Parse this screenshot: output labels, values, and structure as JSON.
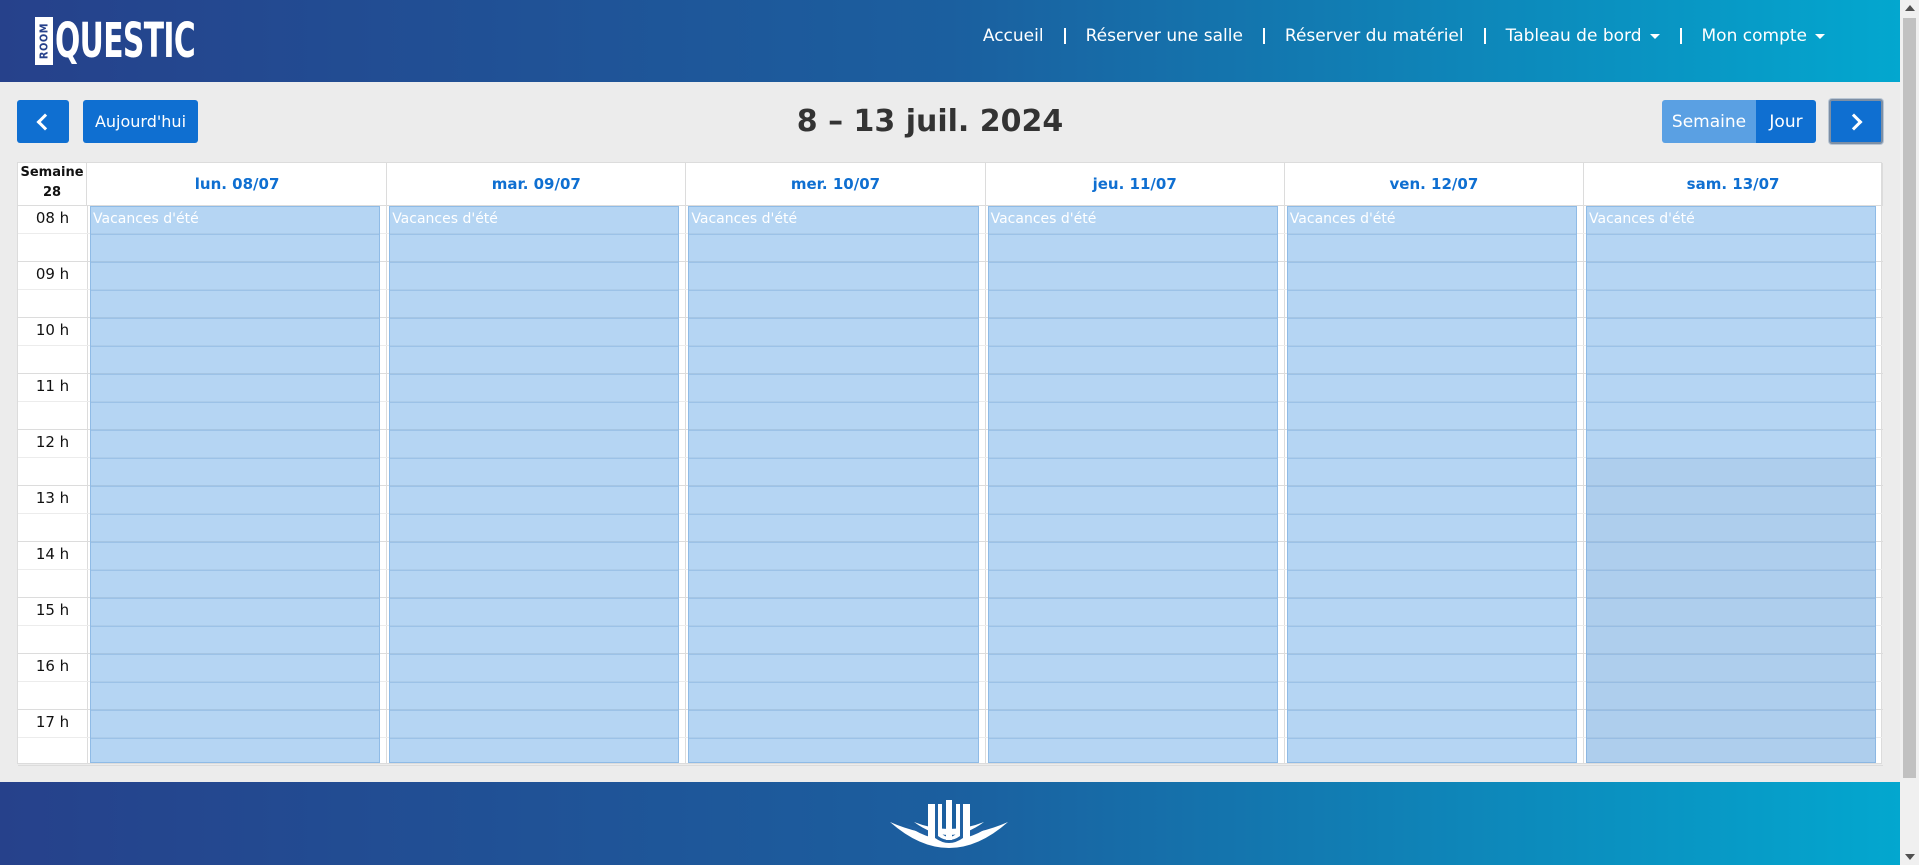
{
  "header": {
    "logo_small": "ROOM",
    "logo_text": "QUESTIC",
    "nav": [
      {
        "label": "Accueil",
        "dropdown": false
      },
      {
        "label": "Réserver une salle",
        "dropdown": false
      },
      {
        "label": "Réserver du matériel",
        "dropdown": false
      },
      {
        "label": "Tableau de bord",
        "dropdown": true
      },
      {
        "label": "Mon compte",
        "dropdown": true
      }
    ]
  },
  "toolbar": {
    "today_label": "Aujourd'hui",
    "title": "8 – 13 juil. 2024",
    "view_week": "Semaine",
    "view_day": "Jour",
    "active_view": "Semaine"
  },
  "calendar": {
    "week_label": "Semaine",
    "week_number": "28",
    "days": [
      "lun. 08/07",
      "mar. 09/07",
      "mer. 10/07",
      "jeu. 11/07",
      "ven. 12/07",
      "sam. 13/07"
    ],
    "hours": [
      "08 h",
      "09 h",
      "10 h",
      "11 h",
      "12 h",
      "13 h",
      "14 h",
      "15 h",
      "16 h",
      "17 h"
    ],
    "event_label": "Vacances d'été"
  },
  "colors": {
    "brand_dark": "#26418b",
    "brand_light": "#03a7cf",
    "button": "#0f6fd1",
    "event": "#b3d3f0"
  }
}
